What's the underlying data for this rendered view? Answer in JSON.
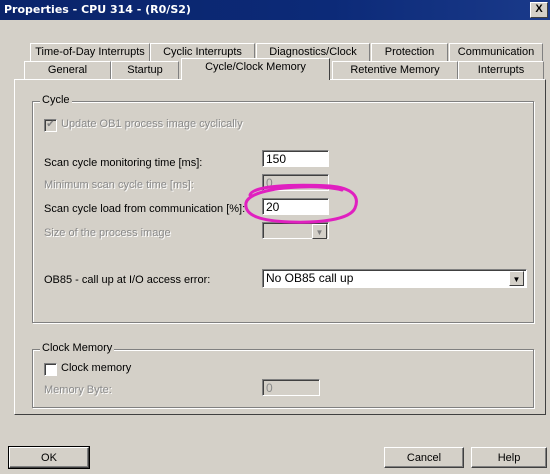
{
  "window": {
    "title": "Properties - CPU 314 - (R0/S2)",
    "close_glyph": "X"
  },
  "tabs_row1": [
    "Time-of-Day Interrupts",
    "Cyclic Interrupts",
    "Diagnostics/Clock",
    "Protection",
    "Communication"
  ],
  "tabs_row2": [
    "General",
    "Startup",
    "Cycle/Clock Memory",
    "Retentive Memory",
    "Interrupts"
  ],
  "active_tab": "Cycle/Clock Memory",
  "cycle": {
    "group_label": "Cycle",
    "update_ob1_label": "Update OB1 process image cyclically",
    "update_ob1_checked": true,
    "scan_monitor_label": "Scan cycle monitoring time [ms]:",
    "scan_monitor_value": "150",
    "min_scan_label": "Minimum scan cycle time [ms]:",
    "min_scan_value": "0",
    "load_comm_label": "Scan cycle load from communication [%]:",
    "load_comm_value": "20",
    "process_image_label": "Size of the process image",
    "process_image_value": "",
    "ob85_label": "OB85 - call up at I/O access error:",
    "ob85_value": "No OB85 call up"
  },
  "clock": {
    "group_label": "Clock Memory",
    "clock_memory_label": "Clock memory",
    "clock_memory_checked": false,
    "memory_byte_label": "Memory Byte:",
    "memory_byte_value": "0"
  },
  "buttons": {
    "ok": "OK",
    "cancel": "Cancel",
    "help": "Help"
  },
  "annotation": {
    "color": "#e020c0"
  }
}
